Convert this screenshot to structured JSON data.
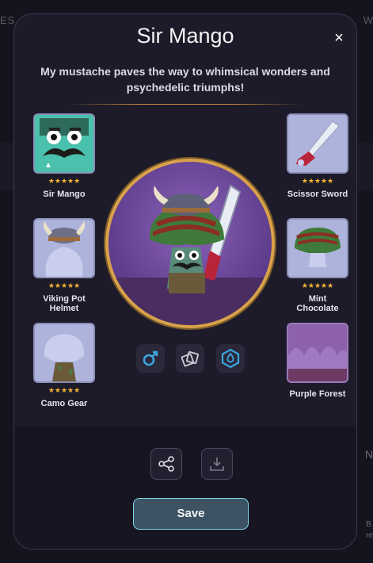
{
  "background": {
    "left_text": "ES",
    "right_text": "W",
    "right_letter": "N",
    "small_lines": [
      "B",
      "re"
    ]
  },
  "modal": {
    "title": "Sir Mango",
    "description": "My mustache paves the way to whimsical wonders and psychedelic triumphs!",
    "close_glyph": "×"
  },
  "left_slots": [
    {
      "label": "Sir Mango",
      "stars": "★★★★★",
      "icon": "mustache-face-icon"
    },
    {
      "label": "Viking Pot Helmet",
      "stars": "★★★★★",
      "icon": "viking-helmet-icon"
    },
    {
      "label": "Camo Gear",
      "stars": "★★★★★",
      "icon": "camo-gear-icon"
    }
  ],
  "right_slots": [
    {
      "label": "Scissor Sword",
      "stars": "★★★★★",
      "icon": "scissor-sword-icon"
    },
    {
      "label": "Mint Chocolate",
      "stars": "★★★★★",
      "icon": "mushroom-cap-icon"
    },
    {
      "label": "Purple Forest",
      "stars": "",
      "icon": "forest-background-icon"
    }
  ],
  "attributes": [
    "male-icon",
    "cards-icon",
    "water-drop-hex-icon"
  ],
  "actions": {
    "save_label": "Save",
    "share_icon": "share-icon",
    "download_icon": "download-icon"
  },
  "colors": {
    "accent": "#7fd6e8",
    "star": "#f3b431",
    "frame": "#d9a24a",
    "slot_bg": "#aeb3dc"
  }
}
